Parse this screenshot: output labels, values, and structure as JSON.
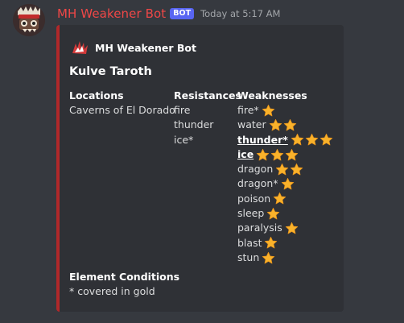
{
  "message": {
    "author": "MH Weakener Bot",
    "bot_tag": "BOT",
    "timestamp": "Today at 5:17 AM"
  },
  "embed": {
    "author_name": "MH Weakener Bot",
    "title": "Kulve Taroth",
    "accent_color": "#b0282a",
    "fields": {
      "locations": {
        "name": "Locations",
        "values": [
          "Caverns of El Dorado"
        ]
      },
      "resistances": {
        "name": "Resistances",
        "values": [
          "fire",
          "thunder",
          "ice*"
        ]
      },
      "weaknesses": {
        "name": "Weaknesses",
        "items": [
          {
            "label": "fire*",
            "stars": 1,
            "highlight": false
          },
          {
            "label": "water",
            "stars": 2,
            "highlight": false
          },
          {
            "label": "thunder*",
            "stars": 3,
            "highlight": true
          },
          {
            "label": "ice",
            "stars": 3,
            "highlight": true
          },
          {
            "label": "dragon",
            "stars": 2,
            "highlight": false
          },
          {
            "label": "dragon*",
            "stars": 1,
            "highlight": false
          },
          {
            "label": "poison",
            "stars": 1,
            "highlight": false
          },
          {
            "label": "sleep",
            "stars": 1,
            "highlight": false
          },
          {
            "label": "paralysis",
            "stars": 1,
            "highlight": false
          },
          {
            "label": "blast",
            "stars": 1,
            "highlight": false
          },
          {
            "label": "stun",
            "stars": 1,
            "highlight": false
          }
        ]
      },
      "element_conditions": {
        "name": "Element Conditions",
        "value": "* covered in gold"
      }
    }
  },
  "icons": {
    "avatar": "monster-face-icon",
    "embed_author": "claw-mark-icon",
    "weakness_rating": "star-icon"
  },
  "colors": {
    "author": "#f04747",
    "bot_tag": "#5865f2",
    "star": "#f9b22b"
  }
}
